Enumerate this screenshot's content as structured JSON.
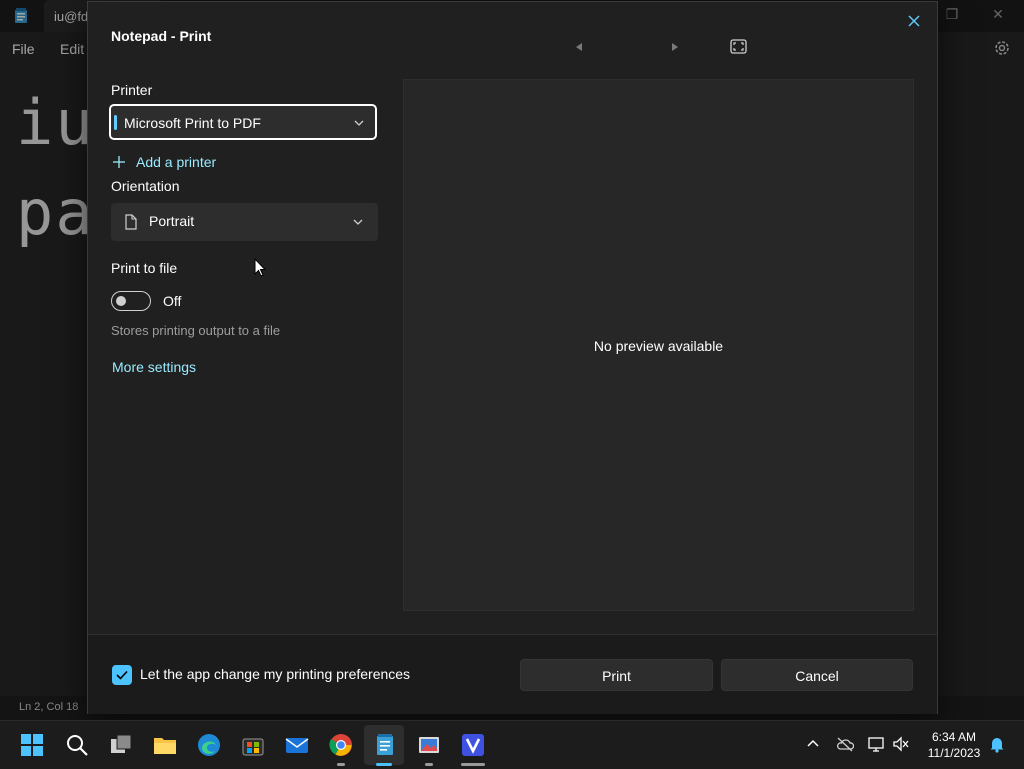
{
  "notepad": {
    "tab_label": "iu@fd",
    "menu": {
      "file": "File",
      "edit": "Edit"
    },
    "editor_lines": [
      "iu",
      "pa"
    ],
    "status": "Ln 2, Col 18"
  },
  "dialog": {
    "title": "Notepad - Print",
    "printer": {
      "label": "Printer",
      "selected": "Microsoft Print to PDF",
      "add_label": "Add a printer"
    },
    "orientation": {
      "label": "Orientation",
      "selected": "Portrait"
    },
    "print_to_file": {
      "label": "Print to file",
      "toggle_state": "Off",
      "description": "Stores printing output to a file"
    },
    "more_settings": "More settings",
    "preview_text": "No preview available",
    "footer": {
      "checkbox_label": "Let the app change my printing preferences",
      "print_button": "Print",
      "cancel_button": "Cancel"
    }
  },
  "taskbar": {
    "clock": {
      "time": "6:34 AM",
      "date": "11/1/2023"
    }
  },
  "colors": {
    "accent": "#60cdff",
    "link": "#99ebff",
    "checkbox": "#4cc2ff"
  }
}
